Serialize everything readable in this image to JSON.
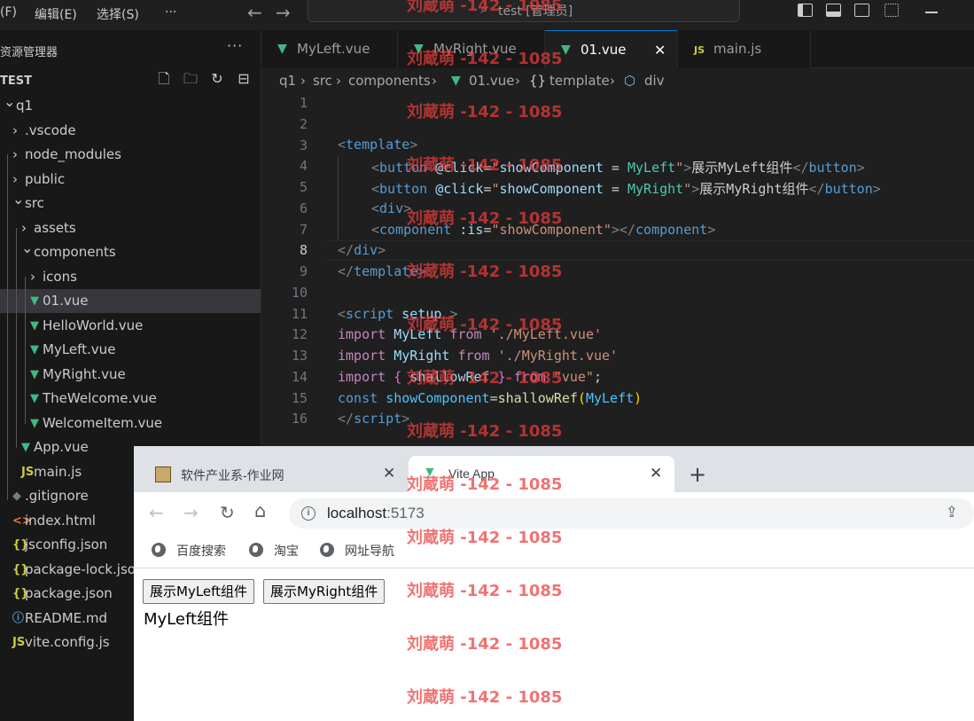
{
  "vscode": {
    "menu": [
      "(F)",
      "编辑(E)",
      "选择(S)",
      "···"
    ],
    "command_center": "test [管理员]",
    "explorer": {
      "title": "资源管理器",
      "more": "···",
      "section": "TEST",
      "tree": [
        {
          "label": "q1",
          "depth": 0,
          "expanded": true,
          "icon": "chevron-down"
        },
        {
          "label": ".vscode",
          "depth": 1,
          "icon": "chevron-right"
        },
        {
          "label": "node_modules",
          "depth": 1,
          "icon": "chevron-right"
        },
        {
          "label": "public",
          "depth": 1,
          "icon": "chevron-right"
        },
        {
          "label": "src",
          "depth": 1,
          "expanded": true,
          "icon": "chevron-down"
        },
        {
          "label": "assets",
          "depth": 2,
          "icon": "chevron-right"
        },
        {
          "label": "components",
          "depth": 2,
          "expanded": true,
          "icon": "chevron-down"
        },
        {
          "label": "icons",
          "depth": 3,
          "icon": "chevron-right"
        },
        {
          "label": "01.vue",
          "depth": 3,
          "icon": "vue",
          "selected": true
        },
        {
          "label": "HelloWorld.vue",
          "depth": 3,
          "icon": "vue"
        },
        {
          "label": "MyLeft.vue",
          "depth": 3,
          "icon": "vue"
        },
        {
          "label": "MyRight.vue",
          "depth": 3,
          "icon": "vue"
        },
        {
          "label": "TheWelcome.vue",
          "depth": 3,
          "icon": "vue"
        },
        {
          "label": "WelcomeItem.vue",
          "depth": 3,
          "icon": "vue"
        },
        {
          "label": "App.vue",
          "depth": 2,
          "icon": "vue"
        },
        {
          "label": "main.js",
          "depth": 2,
          "icon": "js"
        },
        {
          "label": ".gitignore",
          "depth": 1,
          "icon": "git"
        },
        {
          "label": "index.html",
          "depth": 1,
          "icon": "html"
        },
        {
          "label": "jsconfig.json",
          "depth": 1,
          "icon": "json"
        },
        {
          "label": "package-lock.json",
          "depth": 1,
          "icon": "json"
        },
        {
          "label": "package.json",
          "depth": 1,
          "icon": "json"
        },
        {
          "label": "README.md",
          "depth": 1,
          "icon": "info"
        },
        {
          "label": "vite.config.js",
          "depth": 1,
          "icon": "js"
        }
      ]
    },
    "tabs": [
      {
        "label": "MyLeft.vue",
        "icon": "vue"
      },
      {
        "label": "MyRight.vue",
        "icon": "vue"
      },
      {
        "label": "01.vue",
        "icon": "vue",
        "active": true
      },
      {
        "label": "main.js",
        "icon": "js"
      }
    ],
    "breadcrumbs": [
      "q1",
      "src",
      "components",
      "01.vue",
      "template",
      "div"
    ],
    "line_numbers": [
      "1",
      "2",
      "3",
      "4",
      "5",
      "6",
      "7",
      "8",
      "9",
      "10",
      "11",
      "12",
      "13",
      "14",
      "15",
      "16"
    ],
    "current_line": "8",
    "code": {
      "l3": {
        "open": "<",
        "tag": "template",
        "close": ">"
      },
      "l4": {
        "open": "<",
        "tag": "button",
        "attr": "@click",
        "eq": "=",
        "q1": "\"",
        "v1": "showComponent",
        "op": " = ",
        "v2": "MyLeft",
        "q2": "\"",
        "gt": ">",
        "text": "展示MyLeft组件",
        "end_open": "</",
        "end_tag": "button",
        "end_close": ">"
      },
      "l5": {
        "open": "<",
        "tag": "button",
        "attr": "@click",
        "eq": "=",
        "q1": "\"",
        "v1": "showComponent",
        "op": " = ",
        "v2": "MyRight",
        "q2": "\"",
        "gt": ">",
        "text": "展示MyRight组件",
        "end_open": "</",
        "end_tag": "button",
        "end_close": ">"
      },
      "l6": {
        "open": "<",
        "tag": "div",
        "close": ">"
      },
      "l7": {
        "open": "<",
        "tag": "component",
        "attr": ":is",
        "eq": "=",
        "val": "\"showComponent\"",
        "gt": "></",
        "end_tag": "component",
        "end_close": ">"
      },
      "l8": {
        "open": "</",
        "tag": "div",
        "close": ">"
      },
      "l9": {
        "open": "</",
        "tag": "template",
        "close": ">"
      },
      "l11": {
        "open": "<",
        "tag": "script",
        "attr": "setup",
        "close": ">"
      },
      "l12": {
        "kw": "import",
        "name": "MyLeft",
        "from": "from",
        "path": "'./MyLeft.vue'"
      },
      "l13": {
        "kw": "import",
        "name": "MyRight",
        "from": "from",
        "path": "'./MyRight.vue'"
      },
      "l14": {
        "kw": "import",
        "lb": "{",
        "name": "shallowRef",
        "rb": "}",
        "from": "from",
        "path": "\"vue\"",
        "semi": ";"
      },
      "l15": {
        "kw": "const",
        "name": "showComponent",
        "eq": "=",
        "fn": "shallowRef",
        "lp": "(",
        "arg": "MyLeft",
        "rp": ")"
      },
      "l16": {
        "open": "</",
        "tag": "script",
        "close": ">"
      }
    }
  },
  "browser": {
    "tabs": [
      {
        "title": "软件产业系-作业网",
        "close": "✕"
      },
      {
        "title": "Vite App",
        "close": "✕",
        "active": true
      }
    ],
    "new_tab": "+",
    "url_host": "localhost",
    "url_port": ":5173",
    "bookmarks": [
      "百度搜索",
      "淘宝",
      "网址导航"
    ],
    "page": {
      "buttons": [
        "展示MyLeft组件",
        "展示MyRight组件"
      ],
      "text": "MyLeft组件"
    }
  },
  "watermark": "刘蔵萌 -142 - 1085",
  "colors": {
    "editor_bg": "#1f1f1f",
    "sidebar_bg": "#181818",
    "accent": "#0078d4",
    "vue_green": "#41b883",
    "js_yellow": "#cbcb41",
    "watermark_red": "#eb3c3c"
  }
}
